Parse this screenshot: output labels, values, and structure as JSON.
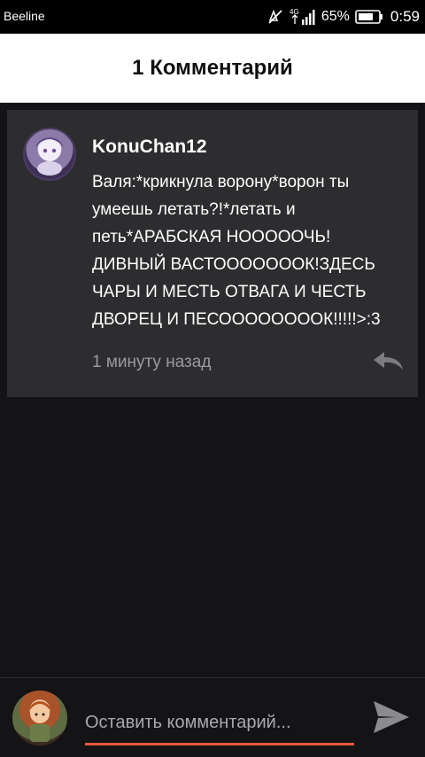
{
  "status_bar": {
    "carrier": "Beeline",
    "network": "4G",
    "battery_percent": "65%",
    "time": "0:59"
  },
  "header": {
    "title": "1 Комментарий"
  },
  "comments": [
    {
      "username": "KonuChan12",
      "text": "Валя:*крикнула ворону*ворон ты умеешь летать?!*летать и петь*АРАБСКАЯ НОООООЧЬ! ДИВНЫЙ ВАСТОООООООК!ЗДЕСЬ ЧАРЫ И МЕСТЬ ОТВАГА И ЧЕСТЬ ДВОРЕЦ И ПЕСООООООООК!!!!!>:3",
      "time_ago": "1 минуту назад"
    }
  ],
  "composer": {
    "placeholder": "Оставить комментарий...",
    "value": ""
  },
  "icons": {
    "reply": "reply-icon",
    "send": "send-icon",
    "mute": "mute-icon",
    "signal": "signal-icon",
    "battery": "battery-icon"
  },
  "colors": {
    "background": "#141315",
    "card": "#2d2c2f",
    "header_bg": "#ffffff",
    "accent": "#e8573a",
    "muted_text": "#9c9a9e"
  }
}
